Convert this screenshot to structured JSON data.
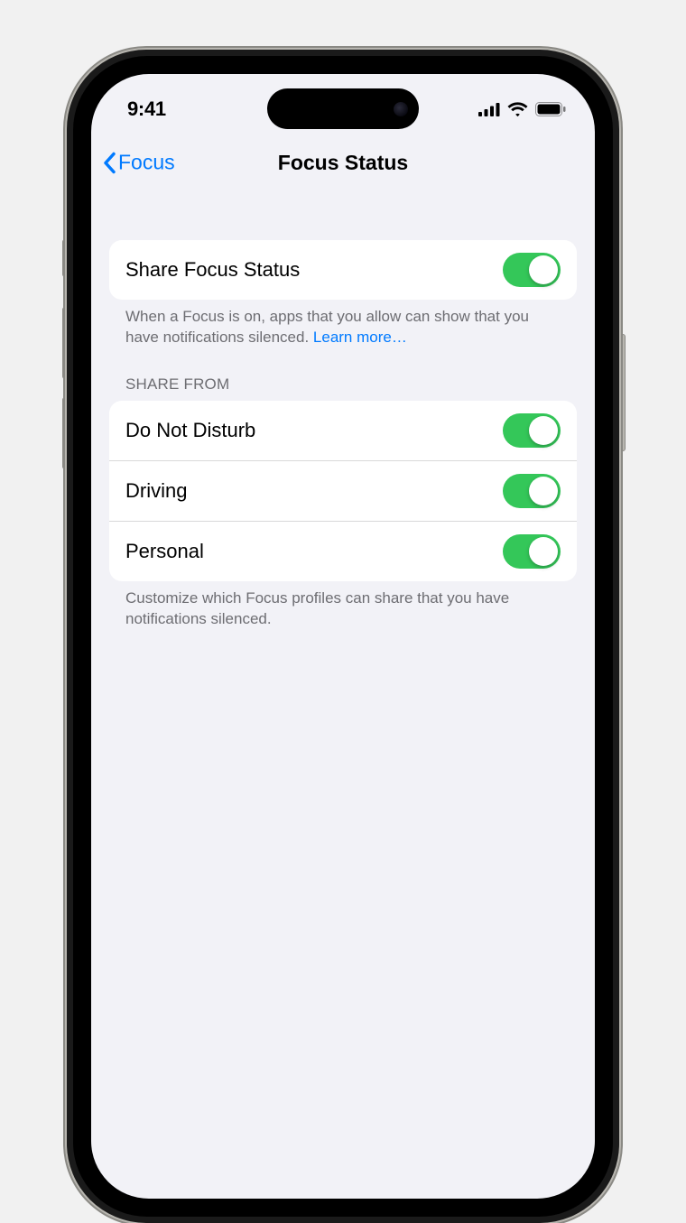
{
  "status": {
    "time": "9:41"
  },
  "nav": {
    "back_label": "Focus",
    "title": "Focus Status"
  },
  "section1": {
    "row_label": "Share Focus Status",
    "toggle_on": true,
    "footer_text": "When a Focus is on, apps that you allow can show that you have notifications silenced. ",
    "link_text": "Learn more…"
  },
  "section2": {
    "header": "SHARE FROM",
    "items": [
      {
        "label": "Do Not Disturb",
        "on": true
      },
      {
        "label": "Driving",
        "on": true
      },
      {
        "label": "Personal",
        "on": true
      }
    ],
    "footer": "Customize which Focus profiles can share that you have notifications silenced."
  }
}
